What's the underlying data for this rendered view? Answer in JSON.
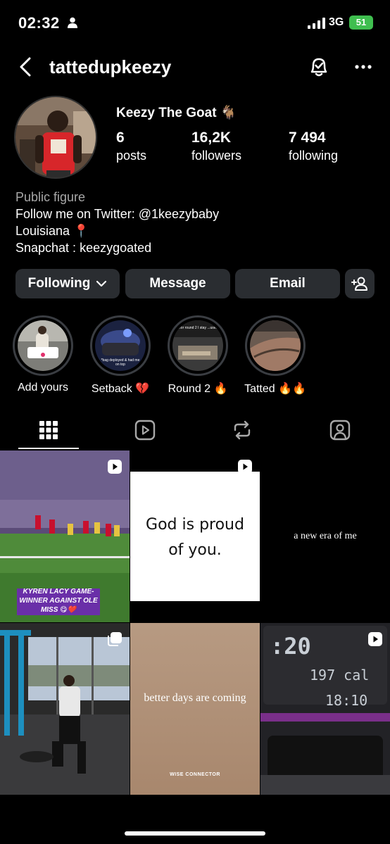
{
  "status_bar": {
    "time": "02:32",
    "network": "3G",
    "battery": "51"
  },
  "header": {
    "username": "tattedupkeezy"
  },
  "profile": {
    "display_name": "Keezy The Goat 🐐",
    "stats": [
      {
        "value": "6",
        "label": "posts"
      },
      {
        "value": "16,2K",
        "label": "followers"
      },
      {
        "value": "7 494",
        "label": "following"
      }
    ],
    "bio": {
      "category": "Public figure",
      "lines": [
        "Follow me on Twitter: @1keezybaby",
        "Louisiana 📍",
        "Snapchat : keezygoated"
      ]
    }
  },
  "actions": {
    "following_label": "Following",
    "message_label": "Message",
    "email_label": "Email"
  },
  "highlights": [
    {
      "label": "Add yours"
    },
    {
      "label": "Setback 💔"
    },
    {
      "label": "Round 2 🔥"
    },
    {
      "label": "Tatted 🔥🔥"
    }
  ],
  "highlight_texts": {
    "setback_caption": "*bag deployed & had me on top",
    "round2_caption": "..for round 2 I stay ...used"
  },
  "posts": [
    {
      "type": "reel",
      "caption": "KYREN LACY GAME-WINNER AGAINST OLE MISS 😋❤️"
    },
    {
      "type": "reel",
      "caption": "God is proud of you."
    },
    {
      "type": "reel",
      "caption": "a new era of me"
    },
    {
      "type": "carousel",
      "caption": ""
    },
    {
      "type": "reel",
      "caption": "better days are coming",
      "credit": "WISE CONNECTOR"
    },
    {
      "type": "reel",
      "caption": "",
      "screen_texts": [
        ":20",
        "197 cal",
        "18:10"
      ]
    }
  ],
  "icons": {
    "back": "chevron-left-icon",
    "bell": "bell-check-icon",
    "more": "more-horizontal-icon",
    "add_person": "add-person-icon",
    "grid": "grid-icon",
    "reels": "reels-icon",
    "reposts": "repost-icon",
    "tagged": "tagged-icon"
  }
}
